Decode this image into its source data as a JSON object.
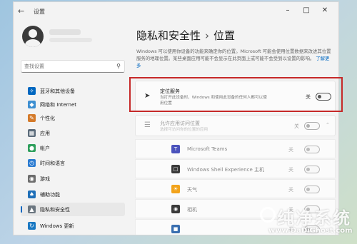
{
  "window": {
    "title": "设置",
    "back_icon": "back-arrow-icon",
    "controls": [
      "minimize-icon",
      "maximize-icon",
      "close-icon"
    ]
  },
  "search": {
    "placeholder": "查找设置",
    "icon": "search-icon"
  },
  "sidebar": {
    "items": [
      {
        "label": "蓝牙和其他设备",
        "icon": "bluetooth-icon",
        "color": "#0067c0",
        "active": false
      },
      {
        "label": "网络和 Internet",
        "icon": "network-icon",
        "color": "#3d8fd1",
        "active": false
      },
      {
        "label": "个性化",
        "icon": "personalization-icon",
        "color": "#d47a2a",
        "active": false
      },
      {
        "label": "应用",
        "icon": "apps-icon",
        "color": "#5b6b7a",
        "active": false
      },
      {
        "label": "帐户",
        "icon": "account-icon",
        "color": "#2e9f5c",
        "active": false
      },
      {
        "label": "时间和语言",
        "icon": "time-language-icon",
        "color": "#2b7bd1",
        "active": false
      },
      {
        "label": "游戏",
        "icon": "gaming-icon",
        "color": "#6c6c6c",
        "active": false
      },
      {
        "label": "辅助功能",
        "icon": "accessibility-icon",
        "color": "#1f6fb8",
        "active": false
      },
      {
        "label": "隐私和安全性",
        "icon": "shield-icon",
        "color": "#6b7680",
        "active": true
      },
      {
        "label": "Windows 更新",
        "icon": "windows-update-icon",
        "color": "#1a78c2",
        "active": false
      }
    ]
  },
  "breadcrumb": {
    "parent": "隐私和安全性",
    "separator": "›",
    "current": "位置"
  },
  "description": {
    "text": "Windows 可以使用你设备的功能来确定你的位置。Microsoft 可能会使用位置数据来改进其位置服务的地理位置。某些桌面应用可能不会显示在此页面上或可能不会受到以设置的影响。",
    "link": "了解更多"
  },
  "location_service": {
    "icon": "location-arrow-icon",
    "title": "定位服务",
    "subtitle": "当打开此设备时，Windows 和使用此设备的任何人都可以使用位置",
    "state": "关",
    "on": false
  },
  "app_access": {
    "icon": "app-list-icon",
    "title": "允许应用访问位置",
    "subtitle": "选择可访问你的位置的应用",
    "state": "关",
    "on": false,
    "chevron": "chevron-up-icon"
  },
  "apps": [
    {
      "name": "Microsoft Teams",
      "icon": "teams-icon",
      "color": "#4b53bc",
      "state": "关"
    },
    {
      "name": "Windows Shell Experience 主机",
      "icon": "shell-icon",
      "color": "#3a3a3a",
      "state": "关"
    },
    {
      "name": "天气",
      "icon": "weather-icon",
      "color": "#f2a31b",
      "state": "关"
    },
    {
      "name": "相机",
      "icon": "camera-icon",
      "color": "#3b3b3b",
      "state": "关"
    },
    {
      "name": "",
      "icon": "app-icon",
      "color": "#3a6fb0",
      "state": "关"
    }
  ],
  "watermark": {
    "line1": "纯净系统",
    "line2": "www.DaDiGhost.com"
  }
}
